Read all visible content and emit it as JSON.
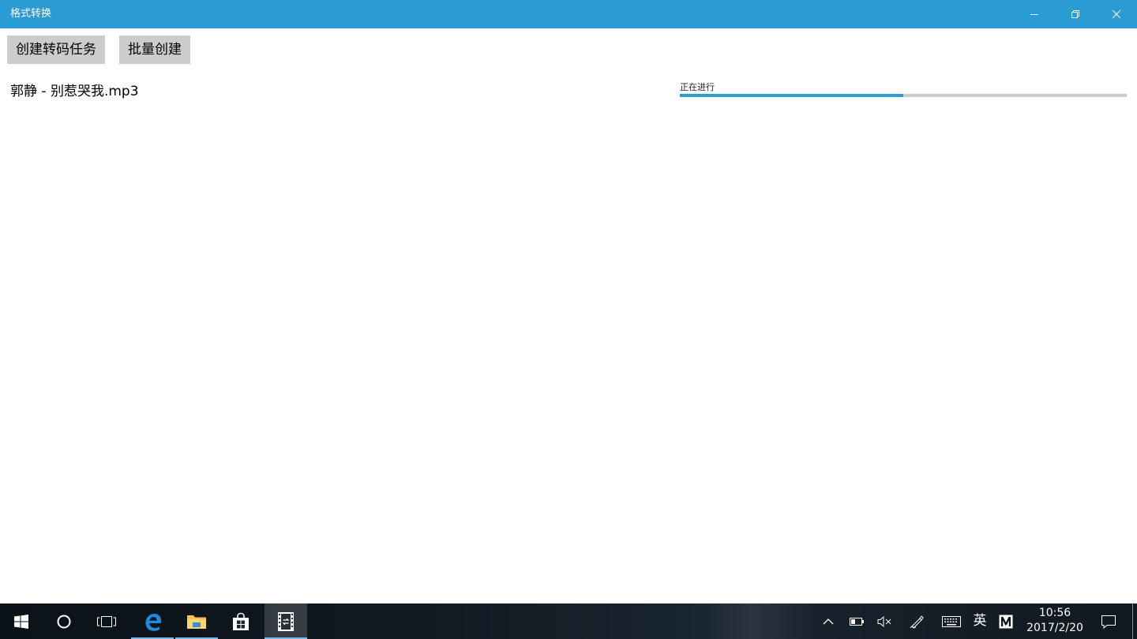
{
  "window": {
    "title": "格式转换"
  },
  "toolbar": {
    "create_task_label": "创建转码任务",
    "batch_create_label": "批量创建"
  },
  "tasks": [
    {
      "filename": "郭静 - 别惹哭我.mp3",
      "status": "正在进行",
      "progress_percent": 50
    }
  ],
  "taskbar": {
    "ime_label": "英",
    "time": "10:56",
    "date": "2017/2/20"
  },
  "colors": {
    "accent": "#2b9bd3",
    "button_bg": "#cccccc",
    "progress_track": "#cccccc"
  }
}
